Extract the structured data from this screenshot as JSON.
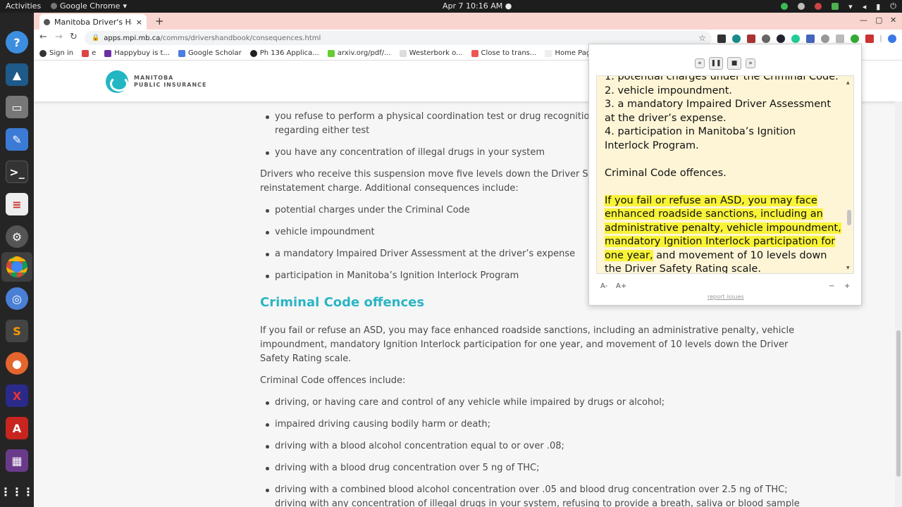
{
  "topbar": {
    "activities": "Activities",
    "app_name": "Google Chrome",
    "clock": "Apr 7  10:16 AM"
  },
  "tab": {
    "title": "Manitoba Driver's Handb",
    "close": "×"
  },
  "omnibox": {
    "host": "apps.mpi.mb.ca",
    "path": "/comms/drivershandbook/consequences.html"
  },
  "bookmarks": [
    {
      "label": "Sign in",
      "icon": "google-icon"
    },
    {
      "label": "e",
      "icon": "gmail-icon"
    },
    {
      "label": "Happybuy is t...",
      "icon": "yahoo-icon"
    },
    {
      "label": "Google Scholar",
      "icon": "scholar-icon"
    },
    {
      "label": "Ph 136 Applica...",
      "icon": "github-icon"
    },
    {
      "label": "arxiv.org/pdf/...",
      "icon": "arxiv-icon"
    },
    {
      "label": "Westerbork o...",
      "icon": "page-icon"
    },
    {
      "label": "Close to trans...",
      "icon": "warning-icon"
    },
    {
      "label": "Home Page of",
      "icon": "page-icon"
    }
  ],
  "site": {
    "logo_line1": "MANITOBA",
    "logo_line2": "PUBLIC INSURANCE"
  },
  "article": {
    "top_bullets": [
      "you refuse to perform a physical coordination test or drug recognition evaluat",
      "regarding either test",
      "you have any concentration of illegal drugs in your system"
    ],
    "para1_line1": "Drivers who receive this suspension move five levels down the Driver Safety Ratin",
    "para1_line2": "reinstatement charge. Additional consequences include:",
    "consequences": [
      "potential charges under the Criminal Code",
      "vehicle impoundment",
      "a mandatory Impaired Driver Assessment at the driver’s expense",
      "participation in Manitoba’s Ignition Interlock Program"
    ],
    "heading": "Criminal Code offences",
    "para2": "If you fail or refuse an ASD, you may face enhanced roadside sanctions, including an administrative penalty, vehicle impoundment, mandatory Ignition Interlock participation for one year, and movement of 10 levels down the Driver Safety Rating scale.",
    "para3": "Criminal Code offences include:",
    "offences": [
      "driving, or having care and control of any vehicle while impaired by drugs or alcohol;",
      "impaired driving causing bodily harm or death;",
      "driving with a blood alcohol concentration equal to or over .08;",
      "driving with a blood drug concentration over 5 ng of THC;",
      "driving with a combined blood alcohol concentration over .05 and blood drug concentration over 2.5 ng of THC; driving with any concentration of illegal drugs in your system, refusing to provide a breath, saliva or blood sample to the police;"
    ]
  },
  "reader": {
    "controls": {
      "prev": "«",
      "pause": "❚❚",
      "stop": "■",
      "next": "»"
    },
    "line_partial": "1. potential charges under the Criminal Code.",
    "item2": "2. vehicle impoundment.",
    "item3": "3. a mandatory Impaired Driver Assessment at the driver’s expense.",
    "item4": "4. participation in Manitoba’s Ignition Interlock Program.",
    "heading": "Criminal Code offences.",
    "highlighted": "If you fail or refuse an ASD, you may face enhanced roadside sanctions, including an administrative penalty, vehicle impoundment, mandatory Ignition Interlock participation for one year,",
    "rest": " and movement of 10 levels down the Driver Safety Rating scale.",
    "font_minus": "A-",
    "font_plus": "A+",
    "rate_minus": "−",
    "rate_plus": "+",
    "report": "report issues",
    "highlight_color": "#f8f337",
    "bg_color": "#fdf5d6"
  },
  "colors": {
    "accent": "#2bb5c4",
    "tabstrip": "#f9d5cf"
  }
}
